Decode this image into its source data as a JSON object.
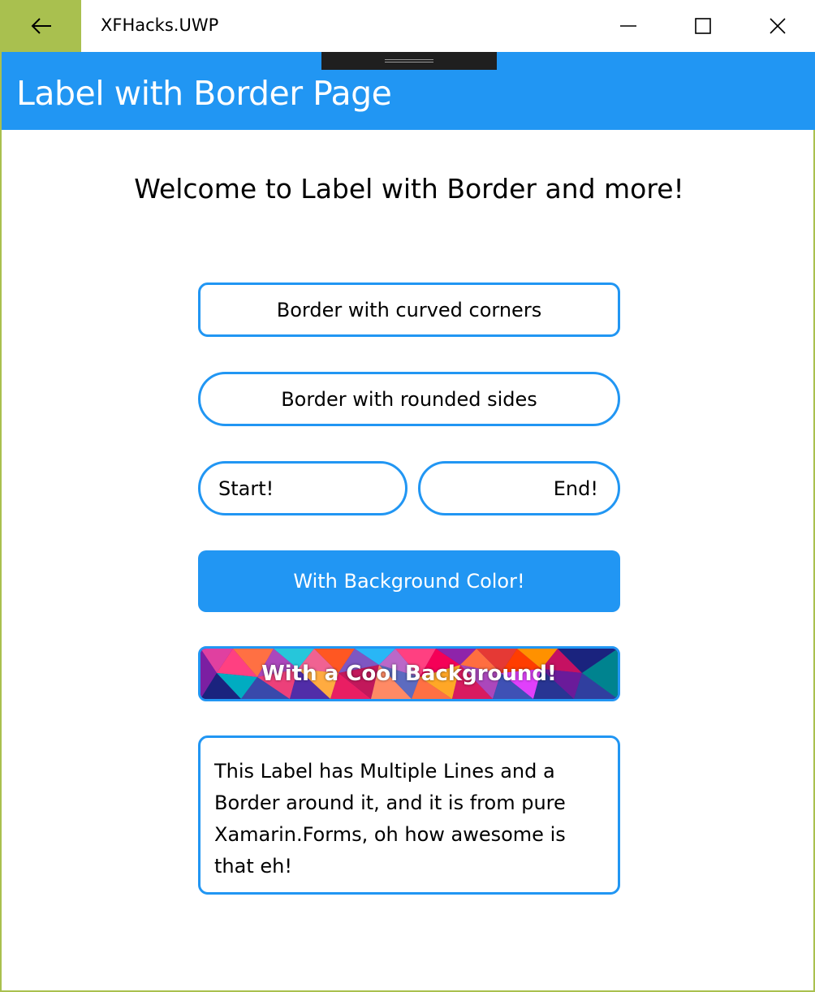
{
  "window": {
    "title": "XFHacks.UWP",
    "accent_color": "#a9c04f",
    "icons": {
      "back": "back-arrow-icon",
      "minimize": "minimize-icon",
      "maximize": "maximize-icon",
      "close": "close-icon"
    }
  },
  "header": {
    "title": "Label with Border Page",
    "color": "#2196f3"
  },
  "content": {
    "welcome": "Welcome to Label with Border and more!",
    "labels": {
      "curved": "Border with curved corners",
      "rounded": "Border with rounded sides",
      "start": "Start!",
      "end": "End!",
      "background_color": "With Background Color!",
      "cool_background": "With a Cool Background!",
      "multiline": "This Label has Multiple Lines and a Border around it, and it is from pure Xamarin.Forms, oh how awesome is that eh!"
    },
    "border_color": "#2196f3"
  }
}
